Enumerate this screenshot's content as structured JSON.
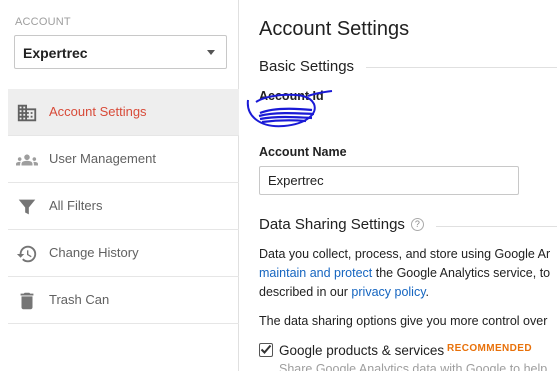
{
  "sidebar": {
    "account_label": "ACCOUNT",
    "account_selected": "Expertrec",
    "items": [
      {
        "label": "Account Settings",
        "icon": "building-icon",
        "active": true
      },
      {
        "label": "User Management",
        "icon": "people-icon",
        "active": false
      },
      {
        "label": "All Filters",
        "icon": "filter-icon",
        "active": false
      },
      {
        "label": "Change History",
        "icon": "history-icon",
        "active": false
      },
      {
        "label": "Trash Can",
        "icon": "trash-icon",
        "active": false
      }
    ]
  },
  "main": {
    "title": "Account Settings",
    "basic_settings": {
      "heading": "Basic Settings",
      "account_id_label": "Account Id",
      "account_name_label": "Account Name",
      "account_name_value": "Expertrec"
    },
    "data_sharing": {
      "heading": "Data Sharing Settings",
      "help_glyph": "?",
      "para1_line1": "Data you collect, process, and store using Google Ar",
      "para1_line2_link": "maintain and protect",
      "para1_line2_rest": " the Google Analytics service, to",
      "para1_line3_pre": "described in our ",
      "para1_line3_link": "privacy policy",
      "para1_line3_post": ".",
      "para2": "The data sharing options give you more control over",
      "option_label": "Google products & services",
      "option_badge": "RECOMMENDED",
      "option_desc": "Share Google Analytics data with Google to help"
    }
  },
  "colors": {
    "active_nav": "#d84a38",
    "link": "#1565c0",
    "badge": "#e8710a",
    "annotation_ink": "#1a1ad6"
  }
}
